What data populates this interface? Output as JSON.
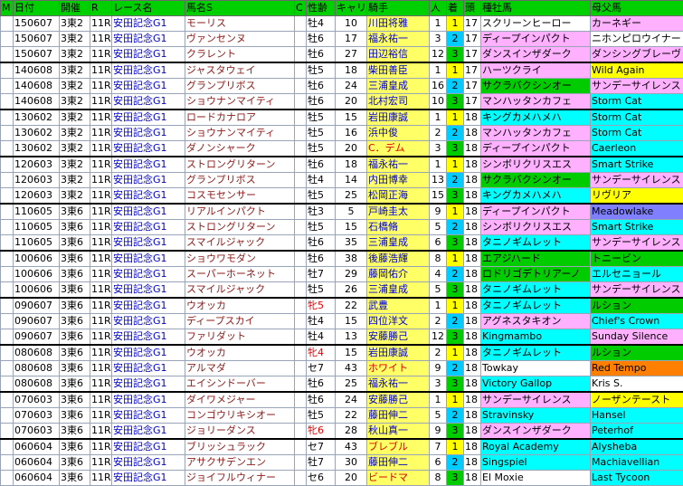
{
  "headers": {
    "m": "M",
    "date": "日付",
    "kai": "開催",
    "r": "R",
    "race": "レース名",
    "horse": "馬名S",
    "c": "C",
    "sex": "性齢",
    "car": "キャリア",
    "jockey": "騎手",
    "ninki": "人",
    "chaku": "着",
    "tou": "頭",
    "sire": "種牡馬",
    "bms": "母父馬"
  },
  "colors": {
    "header": "#00d000",
    "first": "#ffff00",
    "second": "#00ccff",
    "third": "#00cc00"
  },
  "rows": [
    {
      "date": "150607",
      "kai": "3東2",
      "r": "11R",
      "race": "安田記念G1",
      "horse": "モーリス",
      "sex": "牡4",
      "car": "10",
      "jockey": "川田将雅",
      "ninki": "1",
      "chaku": "1",
      "tou": "17",
      "sire": "スクリーンヒーロー",
      "sire_bg": "#ffffff",
      "bms": "カーネギー",
      "bms_bg": "#ffb0ff"
    },
    {
      "date": "150607",
      "kai": "3東2",
      "r": "11R",
      "race": "安田記念G1",
      "horse": "ヴァンセンヌ",
      "sex": "牡6",
      "car": "17",
      "jockey": "福永祐一",
      "ninki": "3",
      "chaku": "2",
      "tou": "17",
      "sire": "ディープインパクト",
      "sire_bg": "#ffb0ff",
      "bms": "ニホンピロウイナー",
      "bms_bg": "#ffffff"
    },
    {
      "date": "150607",
      "kai": "3東2",
      "r": "11R",
      "race": "安田記念G1",
      "horse": "クラレント",
      "sex": "牡6",
      "car": "27",
      "jockey": "田辺裕信",
      "ninki": "12",
      "chaku": "3",
      "tou": "17",
      "sire": "ダンスインザダーク",
      "sire_bg": "#ffb0ff",
      "bms": "ダンシングブレーヴ",
      "bms_bg": "#ffb0ff"
    },
    {
      "date": "140608",
      "kai": "3東2",
      "r": "11R",
      "race": "安田記念G1",
      "horse": "ジャスタウェイ",
      "sex": "牡5",
      "car": "18",
      "jockey": "柴田善臣",
      "ninki": "1",
      "chaku": "1",
      "tou": "17",
      "sire": "ハーツクライ",
      "sire_bg": "#ffb0ff",
      "bms": "Wild Again",
      "bms_bg": "#ffff00",
      "sep": true
    },
    {
      "date": "140608",
      "kai": "3東2",
      "r": "11R",
      "race": "安田記念G1",
      "horse": "グランプリボス",
      "sex": "牡6",
      "car": "24",
      "jockey": "三浦皇成",
      "ninki": "16",
      "chaku": "2",
      "tou": "17",
      "sire": "サクラバクシンオー",
      "sire_bg": "#00cc00",
      "bms": "サンデーサイレンス",
      "bms_bg": "#ffb0ff"
    },
    {
      "date": "140608",
      "kai": "3東2",
      "r": "11R",
      "race": "安田記念G1",
      "horse": "ショウナンマイティ",
      "sex": "牡6",
      "car": "20",
      "jockey": "北村宏司",
      "ninki": "10",
      "chaku": "3",
      "tou": "17",
      "sire": "マンハッタンカフェ",
      "sire_bg": "#ffb0ff",
      "bms": "Storm Cat",
      "bms_bg": "#00ffff"
    },
    {
      "date": "130602",
      "kai": "3東2",
      "r": "11R",
      "race": "安田記念G1",
      "horse": "ロードカナロア",
      "sex": "牡5",
      "car": "15",
      "jockey": "岩田康誠",
      "ninki": "1",
      "chaku": "1",
      "tou": "18",
      "sire": "キングカメハメハ",
      "sire_bg": "#00ffff",
      "bms": "Storm Cat",
      "bms_bg": "#00ffff",
      "sep": true
    },
    {
      "date": "130602",
      "kai": "3東2",
      "r": "11R",
      "race": "安田記念G1",
      "horse": "ショウナンマイティ",
      "sex": "牡5",
      "car": "16",
      "jockey": "浜中俊",
      "ninki": "2",
      "chaku": "2",
      "tou": "18",
      "sire": "マンハッタンカフェ",
      "sire_bg": "#ffb0ff",
      "bms": "Storm Cat",
      "bms_bg": "#00ffff"
    },
    {
      "date": "130602",
      "kai": "3東2",
      "r": "11R",
      "race": "安田記念G1",
      "horse": "ダノンシャーク",
      "sex": "牡5",
      "car": "20",
      "jockey": "C．デム",
      "ninki": "3",
      "chaku": "3",
      "tou": "18",
      "sire": "ディープインパクト",
      "sire_bg": "#ffb0ff",
      "bms": "Caerleon",
      "bms_bg": "#00ffff",
      "jk_red": true
    },
    {
      "date": "120603",
      "kai": "3東2",
      "r": "11R",
      "race": "安田記念G1",
      "horse": "ストロングリターン",
      "sex": "牡6",
      "car": "18",
      "jockey": "福永祐一",
      "ninki": "1",
      "chaku": "1",
      "tou": "18",
      "sire": "シンボリクリスエス",
      "sire_bg": "#ffb0ff",
      "bms": "Smart Strike",
      "bms_bg": "#00ffff",
      "sep": true
    },
    {
      "date": "120603",
      "kai": "3東2",
      "r": "11R",
      "race": "安田記念G1",
      "horse": "グランプリボス",
      "sex": "牡4",
      "car": "14",
      "jockey": "内田博幸",
      "ninki": "13",
      "chaku": "2",
      "tou": "18",
      "sire": "サクラバクシンオー",
      "sire_bg": "#00cc00",
      "bms": "サンデーサイレンス",
      "bms_bg": "#ffb0ff"
    },
    {
      "date": "120603",
      "kai": "3東2",
      "r": "11R",
      "race": "安田記念G1",
      "horse": "コスモセンサー",
      "sex": "牡5",
      "car": "25",
      "jockey": "松岡正海",
      "ninki": "15",
      "chaku": "3",
      "tou": "18",
      "sire": "キングカメハメハ",
      "sire_bg": "#00ffff",
      "bms": "リヴリア",
      "bms_bg": "#ffff00"
    },
    {
      "date": "110605",
      "kai": "3東6",
      "r": "11R",
      "race": "安田記念G1",
      "horse": "リアルインパクト",
      "sex": "牡3",
      "car": "5",
      "jockey": "戸崎圭太",
      "ninki": "9",
      "chaku": "1",
      "tou": "18",
      "sire": "ディープインパクト",
      "sire_bg": "#ffb0ff",
      "bms": "Meadowlake",
      "bms_bg": "#8080ff",
      "sep": true
    },
    {
      "date": "110605",
      "kai": "3東6",
      "r": "11R",
      "race": "安田記念G1",
      "horse": "ストロングリターン",
      "sex": "牡5",
      "car": "15",
      "jockey": "石橋脩",
      "ninki": "5",
      "chaku": "2",
      "tou": "18",
      "sire": "シンボリクリスエス",
      "sire_bg": "#ffb0ff",
      "bms": "Smart Strike",
      "bms_bg": "#00ffff"
    },
    {
      "date": "110605",
      "kai": "3東6",
      "r": "11R",
      "race": "安田記念G1",
      "horse": "スマイルジャック",
      "sex": "牡6",
      "car": "35",
      "jockey": "三浦皇成",
      "ninki": "6",
      "chaku": "3",
      "tou": "18",
      "sire": "タニノギムレット",
      "sire_bg": "#00ffff",
      "bms": "サンデーサイレンス",
      "bms_bg": "#ffb0ff"
    },
    {
      "date": "100606",
      "kai": "3東6",
      "r": "11R",
      "race": "安田記念G1",
      "horse": "ショウワモダン",
      "sex": "牡6",
      "car": "38",
      "jockey": "後藤浩輝",
      "ninki": "8",
      "chaku": "1",
      "tou": "18",
      "sire": "エアジハード",
      "sire_bg": "#00cc00",
      "bms": "トニービン",
      "bms_bg": "#00cc00",
      "sep": true
    },
    {
      "date": "100606",
      "kai": "3東6",
      "r": "11R",
      "race": "安田記念G1",
      "horse": "スーパーホーネット",
      "sex": "牡7",
      "car": "29",
      "jockey": "藤岡佑介",
      "ninki": "4",
      "chaku": "2",
      "tou": "18",
      "sire": "ロドリゴデトリアーノ",
      "sire_bg": "#00cc00",
      "bms": "エルセニョール",
      "bms_bg": "#00ffff"
    },
    {
      "date": "100606",
      "kai": "3東6",
      "r": "11R",
      "race": "安田記念G1",
      "horse": "スマイルジャック",
      "sex": "牡5",
      "car": "26",
      "jockey": "三浦皇成",
      "ninki": "5",
      "chaku": "3",
      "tou": "18",
      "sire": "タニノギムレット",
      "sire_bg": "#00ffff",
      "bms": "サンデーサイレンス",
      "bms_bg": "#ffb0ff"
    },
    {
      "date": "090607",
      "kai": "3東6",
      "r": "11R",
      "race": "安田記念G1",
      "horse": "ウオッカ",
      "sex": "牝5",
      "car": "22",
      "jockey": "武豊",
      "ninki": "1",
      "chaku": "1",
      "tou": "18",
      "sire": "タニノギムレット",
      "sire_bg": "#00ffff",
      "bms": "ルション",
      "bms_bg": "#00cc00",
      "sep": true,
      "female": true
    },
    {
      "date": "090607",
      "kai": "3東6",
      "r": "11R",
      "race": "安田記念G1",
      "horse": "ディープスカイ",
      "sex": "牡4",
      "car": "15",
      "jockey": "四位洋文",
      "ninki": "2",
      "chaku": "2",
      "tou": "18",
      "sire": "アグネスタキオン",
      "sire_bg": "#ffb0ff",
      "bms": "Chief's Crown",
      "bms_bg": "#00ffff"
    },
    {
      "date": "090607",
      "kai": "3東6",
      "r": "11R",
      "race": "安田記念G1",
      "horse": "ファリダット",
      "sex": "牡4",
      "car": "13",
      "jockey": "安藤勝己",
      "ninki": "12",
      "chaku": "3",
      "tou": "18",
      "sire": "Kingmambo",
      "sire_bg": "#00ffff",
      "bms": "Sunday Silence",
      "bms_bg": "#ffb0ff"
    },
    {
      "date": "080608",
      "kai": "3東6",
      "r": "11R",
      "race": "安田記念G1",
      "horse": "ウオッカ",
      "sex": "牝4",
      "car": "15",
      "jockey": "岩田康誠",
      "ninki": "2",
      "chaku": "1",
      "tou": "18",
      "sire": "タニノギムレット",
      "sire_bg": "#00ffff",
      "bms": "ルション",
      "bms_bg": "#00cc00",
      "sep": true,
      "female": true
    },
    {
      "date": "080608",
      "kai": "3東6",
      "r": "11R",
      "race": "安田記念G1",
      "horse": "アルマダ",
      "sex": "セ7",
      "car": "43",
      "jockey": "ホワイト",
      "ninki": "9",
      "chaku": "2",
      "tou": "18",
      "sire": "Towkay",
      "sire_bg": "#ffffff",
      "bms": "Red Tempo",
      "bms_bg": "#ff8000",
      "jk_red": true
    },
    {
      "date": "080608",
      "kai": "3東6",
      "r": "11R",
      "race": "安田記念G1",
      "horse": "エイシンドーバー",
      "sex": "牡6",
      "car": "25",
      "jockey": "福永祐一",
      "ninki": "3",
      "chaku": "3",
      "tou": "18",
      "sire": "Victory Gallop",
      "sire_bg": "#00ffff",
      "bms": "Kris S.",
      "bms_bg": "#ffffff"
    },
    {
      "date": "070603",
      "kai": "3東6",
      "r": "11R",
      "race": "安田記念G1",
      "horse": "ダイワメジャー",
      "sex": "牡6",
      "car": "24",
      "jockey": "安藤勝己",
      "ninki": "1",
      "chaku": "1",
      "tou": "18",
      "sire": "サンデーサイレンス",
      "sire_bg": "#ffb0ff",
      "bms": "ノーザンテースト",
      "bms_bg": "#ffff00",
      "sep": true
    },
    {
      "date": "070603",
      "kai": "3東6",
      "r": "11R",
      "race": "安田記念G1",
      "horse": "コンゴウリキシオー",
      "sex": "牡5",
      "car": "22",
      "jockey": "藤田伸二",
      "ninki": "5",
      "chaku": "2",
      "tou": "18",
      "sire": "Stravinsky",
      "sire_bg": "#00ffff",
      "bms": "Hansel",
      "bms_bg": "#00ffff"
    },
    {
      "date": "070603",
      "kai": "3東6",
      "r": "11R",
      "race": "安田記念G1",
      "horse": "ジョリーダンス",
      "sex": "牝6",
      "car": "28",
      "jockey": "秋山真一",
      "ninki": "9",
      "chaku": "3",
      "tou": "18",
      "sire": "ダンスインザダーク",
      "sire_bg": "#ffb0ff",
      "bms": "Peterhof",
      "bms_bg": "#00ffff",
      "female": true
    },
    {
      "date": "060604",
      "kai": "3東6",
      "r": "11R",
      "race": "安田記念G1",
      "horse": "ブリッシュラック",
      "sex": "セ7",
      "car": "43",
      "jockey": "ブレブル",
      "ninki": "7",
      "chaku": "1",
      "tou": "18",
      "sire": "Royal Academy",
      "sire_bg": "#00ffff",
      "bms": "Alysheba",
      "bms_bg": "#00ffff",
      "sep": true,
      "jk_red": true
    },
    {
      "date": "060604",
      "kai": "3東6",
      "r": "11R",
      "race": "安田記念G1",
      "horse": "アサクサデンエン",
      "sex": "牡7",
      "car": "30",
      "jockey": "藤田伸二",
      "ninki": "6",
      "chaku": "2",
      "tou": "18",
      "sire": "Singspiel",
      "sire_bg": "#00ffff",
      "bms": "Machiavellian",
      "bms_bg": "#00ffff"
    },
    {
      "date": "060604",
      "kai": "3東6",
      "r": "11R",
      "race": "安田記念G1",
      "horse": "ジョイフルウィナー",
      "sex": "セ6",
      "car": "20",
      "jockey": "ビードマ",
      "ninki": "8",
      "chaku": "3",
      "tou": "18",
      "sire": "El Moxie",
      "sire_bg": "#ffffff",
      "bms": "Last Tycoon",
      "bms_bg": "#00ffff",
      "jk_red": true
    }
  ]
}
